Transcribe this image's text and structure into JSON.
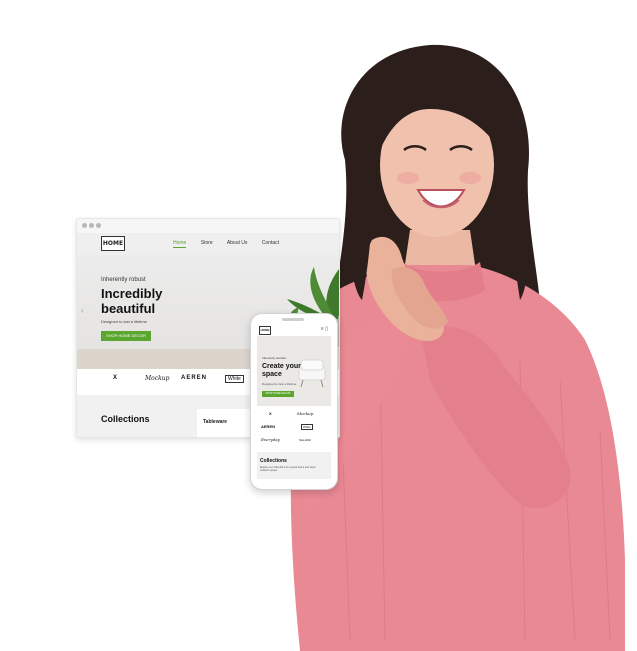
{
  "browser": {
    "logo": "HOME",
    "nav": [
      "Home",
      "Store",
      "About Us",
      "Contact"
    ],
    "hero": {
      "kicker": "Inherently robust",
      "title_line1": "Incredibly",
      "title_line2": "beautiful",
      "subtitle": "Designed to last a lifetime",
      "cta": "SHOP HOME DECOR"
    },
    "brand_logos": [
      "X",
      "Mockup",
      "AEREN",
      "White"
    ],
    "collections_title": "Collections",
    "collection_card": "Tableware"
  },
  "phone": {
    "logo": "HOME",
    "hero": {
      "kicker": "Inherently durable",
      "title_line1": "Create your",
      "title_line2": "space",
      "subtitle": "Designed to last a lifetime",
      "cta": "SHOP HOME DECOR"
    },
    "brand_logos": [
      "X",
      "Mockup",
      "AEREN",
      "White",
      "Everyday",
      "Scientific"
    ],
    "collections_title": "Collections",
    "collections_text": "Explore our collections for a great home and wider outdoors space."
  },
  "colors": {
    "accent_green": "#5aa62e",
    "sweater_pink": "#e98994",
    "hair": "#2a1d1a"
  }
}
